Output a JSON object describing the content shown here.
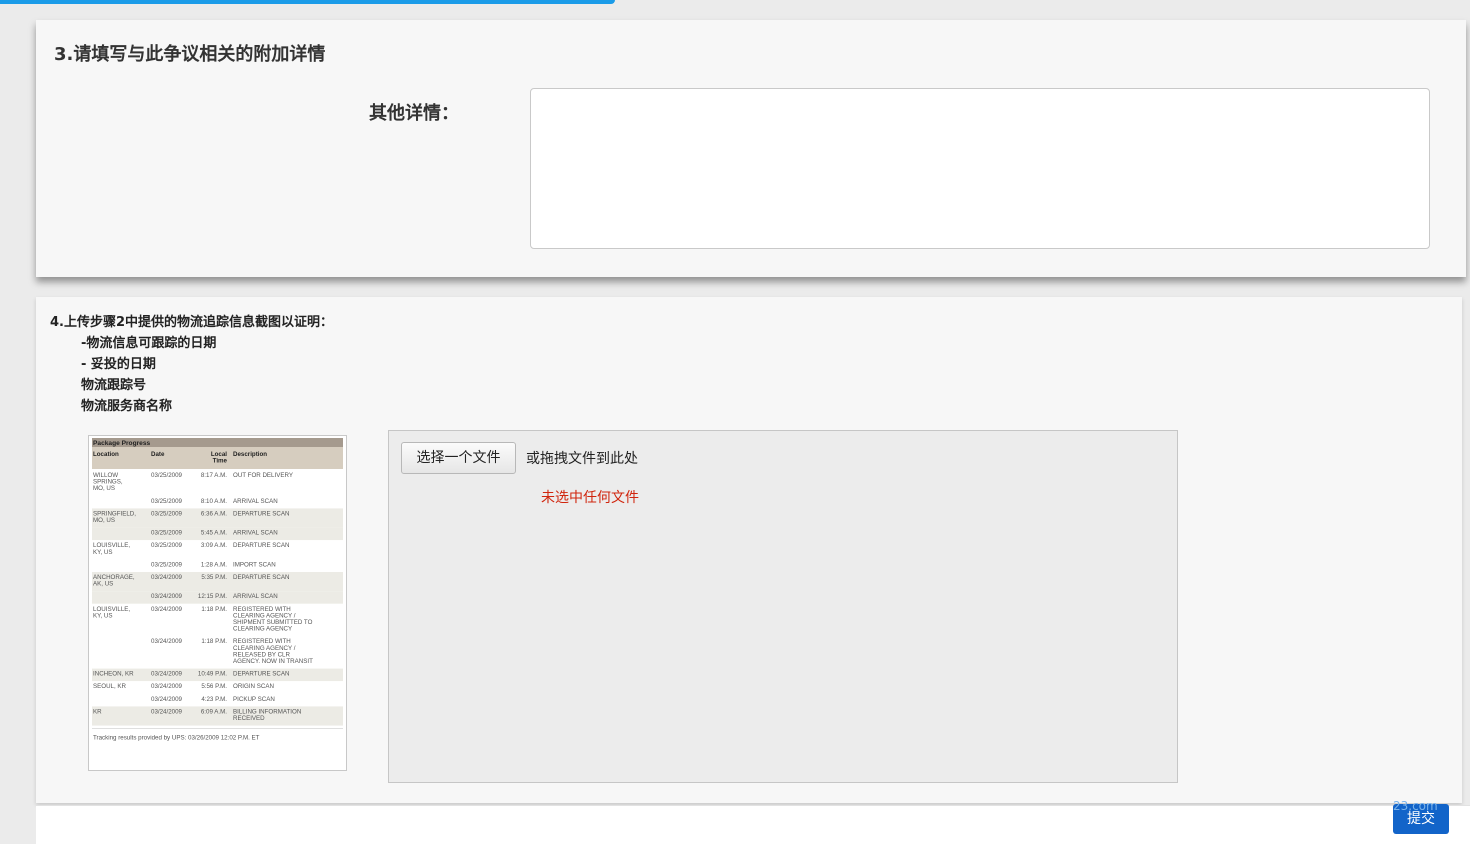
{
  "section3": {
    "title": "3.请填写与此争议相关的附加详情",
    "details_label": "其他详情：",
    "details_value": ""
  },
  "section4": {
    "title": "4.上传步骤2中提供的物流追踪信息截图以证明：",
    "bullets": [
      "-物流信息可跟踪的日期",
      "- 妥投的日期",
      "物流跟踪号",
      "物流服务商名称"
    ],
    "example": {
      "heading": "Package Progress",
      "columns": [
        "Location",
        "Date",
        "Local Time",
        "Description"
      ],
      "footer": "Tracking results provided by UPS: 03/26/2009 12:02 P.M. ET",
      "rows": [
        [
          "WILLOW SPRINGS, MO, US",
          "03/25/2009",
          "8:17 A.M.",
          "OUT FOR DELIVERY"
        ],
        [
          "",
          "03/25/2009",
          "8:10 A.M.",
          "ARRIVAL SCAN"
        ],
        [
          "SPRINGFIELD, MO, US",
          "03/25/2009",
          "6:36 A.M.",
          "DEPARTURE SCAN"
        ],
        [
          "",
          "03/25/2009",
          "5:45 A.M.",
          "ARRIVAL SCAN"
        ],
        [
          "LOUISVILLE, KY, US",
          "03/25/2009",
          "3:09 A.M.",
          "DEPARTURE SCAN"
        ],
        [
          "",
          "03/25/2009",
          "1:28 A.M.",
          "IMPORT SCAN"
        ],
        [
          "ANCHORAGE, AK, US",
          "03/24/2009",
          "5:35 P.M.",
          "DEPARTURE SCAN"
        ],
        [
          "",
          "03/24/2009",
          "12:15 P.M.",
          "ARRIVAL SCAN"
        ],
        [
          "LOUISVILLE, KY, US",
          "03/24/2009",
          "1:18 P.M.",
          "REGISTERED WITH CLEARING AGENCY / SHIPMENT SUBMITTED TO CLEARING AGENCY"
        ],
        [
          "",
          "03/24/2009",
          "1:18 P.M.",
          "REGISTERED WITH CLEARING AGENCY / RELEASED BY CLR AGENCY. NOW IN TRANSIT"
        ],
        [
          "INCHEON, KR",
          "03/24/2009",
          "10:49 P.M.",
          "DEPARTURE SCAN"
        ],
        [
          "SEOUL, KR",
          "03/24/2009",
          "5:56 P.M.",
          "ORIGIN SCAN"
        ],
        [
          "",
          "03/24/2009",
          "4:23 P.M.",
          "PICKUP SCAN"
        ],
        [
          "KR",
          "03/24/2009",
          "6:09 A.M.",
          "BILLING INFORMATION RECEIVED"
        ]
      ]
    },
    "upload": {
      "choose_label": "选择一个文件",
      "drag_hint": "或拖拽文件到此处",
      "no_file": "未选中任何文件"
    }
  },
  "footer": {
    "submit_label": "提交",
    "watermark": "23.com"
  },
  "colors": {
    "accent": "#1a9be8",
    "submit": "#1264c9",
    "error_text": "#d0250d"
  }
}
